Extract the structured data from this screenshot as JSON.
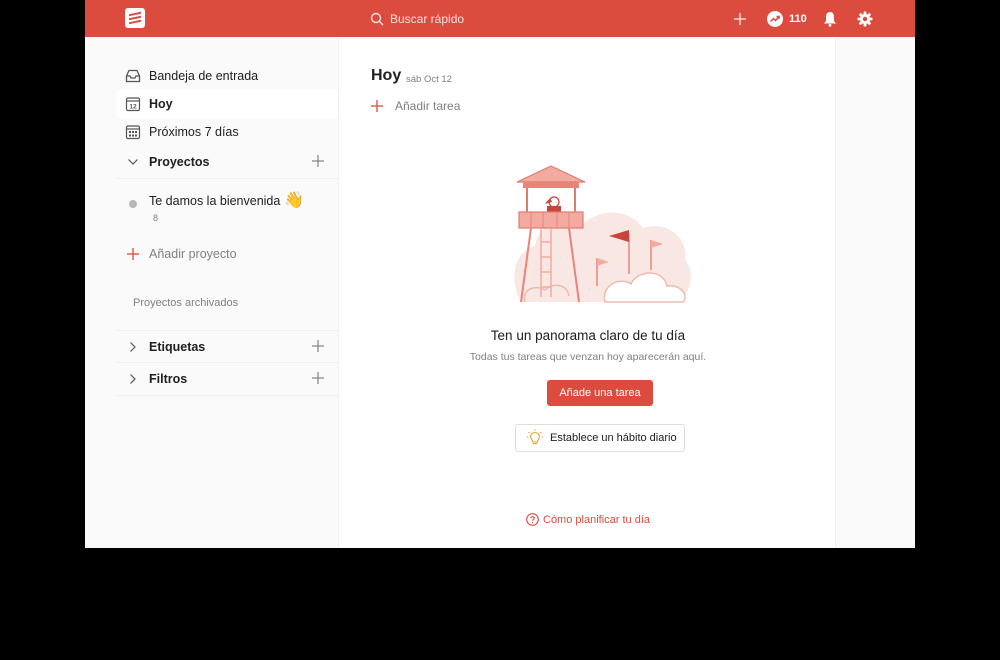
{
  "topbar": {
    "search_placeholder": "Buscar rápido",
    "karma_count": "110",
    "brand_color": "#db4c3f"
  },
  "sidebar": {
    "items": [
      {
        "label": "Bandeja de entrada",
        "icon": "inbox-icon"
      },
      {
        "label": "Hoy",
        "icon": "calendar-today-icon",
        "badge": "12"
      },
      {
        "label": "Próximos 7 días",
        "icon": "calendar-week-icon"
      }
    ],
    "projects_header": "Proyectos",
    "projects": [
      {
        "label": "Te damos la bienvenida",
        "emoji": "👋",
        "count": "8"
      }
    ],
    "add_project": "Añadir proyecto",
    "archived": "Proyectos archivados",
    "labels_header": "Etiquetas",
    "filters_header": "Filtros"
  },
  "main": {
    "title": "Hoy",
    "date": "sáb Oct 12",
    "add_task": "Añadir tarea",
    "empty_title": "Ten un panorama claro de tu día",
    "empty_subtitle": "Todas tus tareas que venzan hoy aparecerán aquí.",
    "add_task_button": "Añade una tarea",
    "habit_button": "Establece un hábito diario",
    "help_link": "Cómo planificar tu día"
  }
}
